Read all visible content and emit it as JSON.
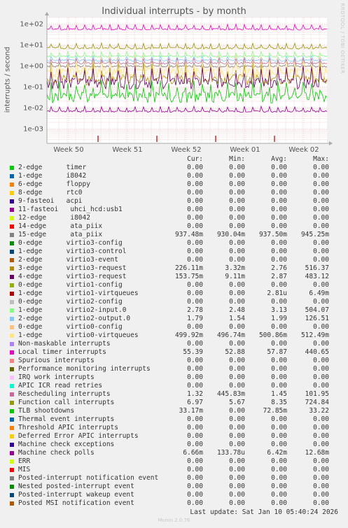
{
  "chart_data": {
    "type": "line",
    "title": "Individual interrupts - by month",
    "ylabel": "interrupts / second",
    "yscale": "log",
    "ylim": [
      0.0002,
      200
    ],
    "yticks": [
      "1e+02",
      "1e+01",
      "1e+00",
      "1e-01",
      "1e-02",
      "1e-03"
    ],
    "xticks": [
      "Week 50",
      "Week 51",
      "Week 52",
      "Week 01",
      "Week 02"
    ],
    "grid": true,
    "columns": [
      "Cur:",
      "Min:",
      "Avg:",
      "Max:"
    ],
    "series": [
      {
        "name": "2-edge      timer",
        "color": "#00cc00",
        "values": [
          "0.00",
          "0.00",
          "0.00",
          "0.00"
        ]
      },
      {
        "name": "1-edge      i8042",
        "color": "#0066b3",
        "values": [
          "0.00",
          "0.00",
          "0.00",
          "0.00"
        ]
      },
      {
        "name": "6-edge      floppy",
        "color": "#ff8000",
        "values": [
          "0.00",
          "0.00",
          "0.00",
          "0.00"
        ]
      },
      {
        "name": "8-edge      rtc0",
        "color": "#ffcc00",
        "values": [
          "0.00",
          "0.00",
          "0.00",
          "0.00"
        ]
      },
      {
        "name": "9-fasteoi   acpi",
        "color": "#330099",
        "values": [
          "0.00",
          "0.00",
          "0.00",
          "0.00"
        ]
      },
      {
        "name": "11-fasteoi   uhci_hcd:usb1",
        "color": "#990099",
        "values": [
          "0.00",
          "0.00",
          "0.00",
          "0.00"
        ]
      },
      {
        "name": "12-edge      i8042",
        "color": "#ccff00",
        "values": [
          "0.00",
          "0.00",
          "0.00",
          "0.00"
        ]
      },
      {
        "name": "14-edge      ata_piix",
        "color": "#ff0000",
        "values": [
          "0.00",
          "0.00",
          "0.00",
          "0.00"
        ]
      },
      {
        "name": "15-edge      ata_piix",
        "color": "#808080",
        "values": [
          "937.48m",
          "930.04m",
          "937.50m",
          "945.25m"
        ]
      },
      {
        "name": "0-edge      virtio3-config",
        "color": "#008f00",
        "values": [
          "0.00",
          "0.00",
          "0.00",
          "0.00"
        ]
      },
      {
        "name": "1-edge      virtio3-control",
        "color": "#00487d",
        "values": [
          "0.00",
          "0.00",
          "0.00",
          "0.00"
        ]
      },
      {
        "name": "2-edge      virtio3-event",
        "color": "#b35a00",
        "values": [
          "0.00",
          "0.00",
          "0.00",
          "0.00"
        ]
      },
      {
        "name": "3-edge      virtio3-request",
        "color": "#b38f00",
        "values": [
          "226.11m",
          "3.32m",
          "2.76",
          "516.37"
        ]
      },
      {
        "name": "4-edge      virtio3-request",
        "color": "#6b006b",
        "values": [
          "153.75m",
          "9.11m",
          "2.87",
          "483.12"
        ]
      },
      {
        "name": "0-edge      virtio1-config",
        "color": "#8fb300",
        "values": [
          "0.00",
          "0.00",
          "0.00",
          "0.00"
        ]
      },
      {
        "name": "1-edge      virtio1-virtqueues",
        "color": "#b30000",
        "values": [
          "0.00",
          "0.00",
          "2.81u",
          "6.49m"
        ]
      },
      {
        "name": "0-edge      virtio2-config",
        "color": "#bebebe",
        "values": [
          "0.00",
          "0.00",
          "0.00",
          "0.00"
        ]
      },
      {
        "name": "1-edge      virtio2-input.0",
        "color": "#80ff80",
        "values": [
          "2.78",
          "2.48",
          "3.13",
          "504.07"
        ]
      },
      {
        "name": "2-edge      virtio2-output.0",
        "color": "#80c9ff",
        "values": [
          "1.79",
          "1.54",
          "1.99",
          "126.51"
        ]
      },
      {
        "name": "0-edge      virtio0-config",
        "color": "#ffc080",
        "values": [
          "0.00",
          "0.00",
          "0.00",
          "0.00"
        ]
      },
      {
        "name": "1-edge      virtio0-virtqueues",
        "color": "#ffe680",
        "values": [
          "499.92m",
          "496.74m",
          "500.86m",
          "512.49m"
        ]
      },
      {
        "name": "Non-maskable interrupts",
        "color": "#aa80ff",
        "values": [
          "0.00",
          "0.00",
          "0.00",
          "0.00"
        ]
      },
      {
        "name": "Local timer interrupts",
        "color": "#ee00cc",
        "values": [
          "55.39",
          "52.88",
          "57.87",
          "440.65"
        ]
      },
      {
        "name": "Spurious interrupts",
        "color": "#ff8080",
        "values": [
          "0.00",
          "0.00",
          "0.00",
          "0.00"
        ]
      },
      {
        "name": "Performance monitoring interrupts",
        "color": "#666600",
        "values": [
          "0.00",
          "0.00",
          "0.00",
          "0.00"
        ]
      },
      {
        "name": "IRQ work interrupts",
        "color": "#ffbfff",
        "values": [
          "0.00",
          "0.00",
          "0.00",
          "0.00"
        ]
      },
      {
        "name": "APIC ICR read retries",
        "color": "#00ffcc",
        "values": [
          "0.00",
          "0.00",
          "0.00",
          "0.00"
        ]
      },
      {
        "name": "Rescheduling interrupts",
        "color": "#cc6699",
        "values": [
          "1.32",
          "445.83m",
          "1.45",
          "101.95"
        ]
      },
      {
        "name": "Function call interrupts",
        "color": "#999900",
        "values": [
          "6.97",
          "5.67",
          "8.35",
          "724.84"
        ]
      },
      {
        "name": "TLB shootdowns",
        "color": "#00cc00",
        "values": [
          "33.17m",
          "0.00",
          "72.85m",
          "33.22"
        ]
      },
      {
        "name": "Thermal event interrupts",
        "color": "#0066b3",
        "values": [
          "0.00",
          "0.00",
          "0.00",
          "0.00"
        ]
      },
      {
        "name": "Threshold APIC interrupts",
        "color": "#ff8000",
        "values": [
          "0.00",
          "0.00",
          "0.00",
          "0.00"
        ]
      },
      {
        "name": "Deferred Error APIC interrupts",
        "color": "#ffcc00",
        "values": [
          "0.00",
          "0.00",
          "0.00",
          "0.00"
        ]
      },
      {
        "name": "Machine check exceptions",
        "color": "#330099",
        "values": [
          "0.00",
          "0.00",
          "0.00",
          "0.00"
        ]
      },
      {
        "name": "Machine check polls",
        "color": "#990099",
        "values": [
          "6.66m",
          "133.78u",
          "6.42m",
          "12.68m"
        ]
      },
      {
        "name": "ERR",
        "color": "#ccff00",
        "values": [
          "0.00",
          "0.00",
          "0.00",
          "0.00"
        ]
      },
      {
        "name": "MIS",
        "color": "#ff0000",
        "values": [
          "0.00",
          "0.00",
          "0.00",
          "0.00"
        ]
      },
      {
        "name": "Posted-interrupt notification event",
        "color": "#808080",
        "values": [
          "0.00",
          "0.00",
          "0.00",
          "0.00"
        ]
      },
      {
        "name": "Nested posted-interrupt event",
        "color": "#008f00",
        "values": [
          "0.00",
          "0.00",
          "0.00",
          "0.00"
        ]
      },
      {
        "name": "Posted-interrupt wakeup event",
        "color": "#00487d",
        "values": [
          "0.00",
          "0.00",
          "0.00",
          "0.00"
        ]
      },
      {
        "name": "Posted MSI notification event",
        "color": "#b35a00",
        "values": [
          "0.00",
          "0.00",
          "0.00",
          "0.00"
        ]
      }
    ]
  },
  "side_note": "RRDTOOL / TOBI OETIKER",
  "footer": "Last update: Sat Jan 10 05:40:24 2026",
  "munin_version": "Munin 2.0.76"
}
